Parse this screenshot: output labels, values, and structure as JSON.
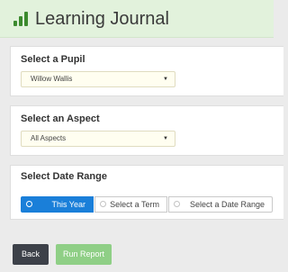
{
  "header": {
    "title": "Learning Journal",
    "icon": "bar-chart-icon",
    "accent": "#3c8a2e"
  },
  "pupil": {
    "label": "Select a Pupil",
    "value": "Willow Wallis",
    "caret": "▼"
  },
  "aspect": {
    "label": "Select an Aspect",
    "value": "All Aspects",
    "caret": "▼"
  },
  "date_range": {
    "label": "Select Date Range",
    "options": [
      {
        "label": "This Year",
        "selected": true
      },
      {
        "label": "Select a Term",
        "selected": false
      },
      {
        "label": "Select a Date Range",
        "selected": false
      }
    ],
    "active_color": "#1a7fd9"
  },
  "actions": {
    "back_label": "Back",
    "run_label": "Run Report",
    "run_color": "#8fcf86"
  }
}
